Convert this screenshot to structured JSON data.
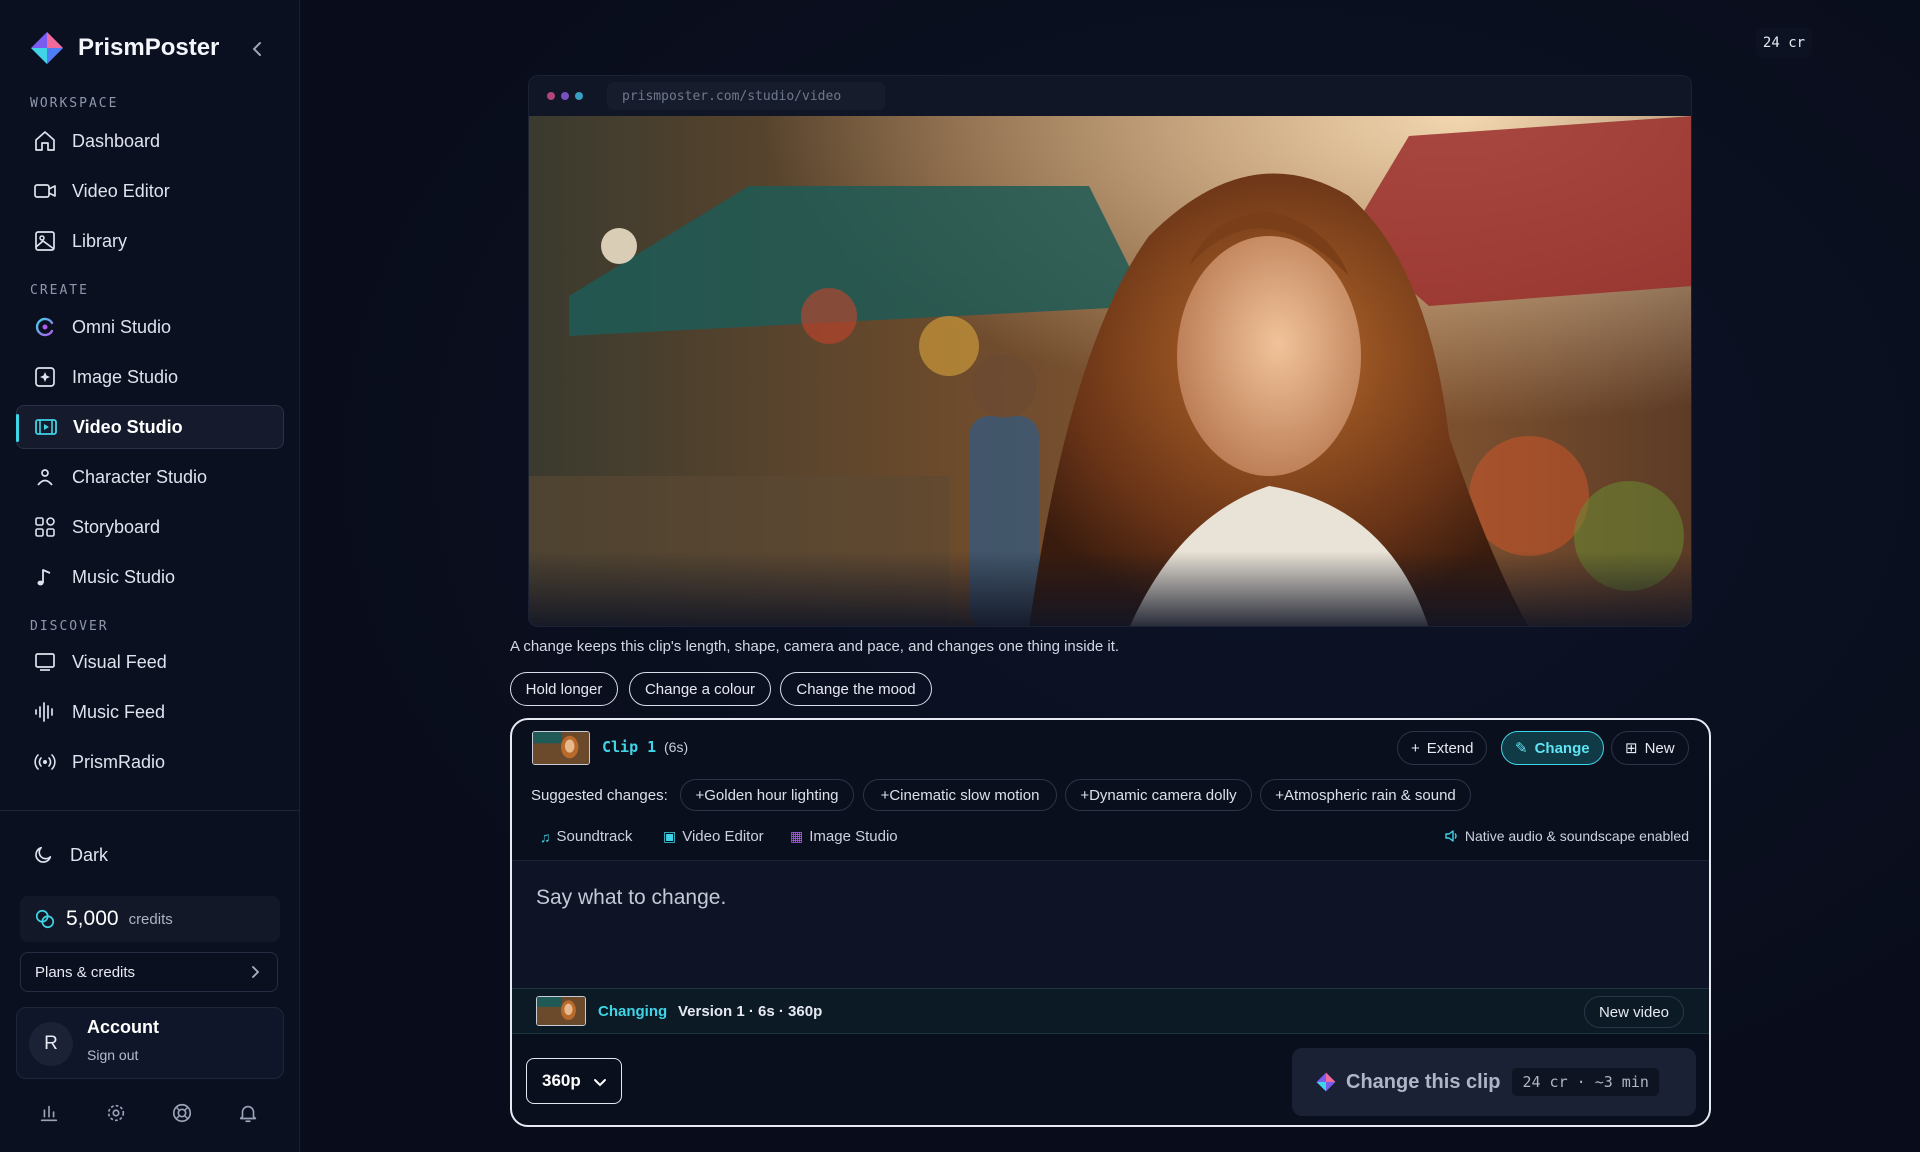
{
  "app": {
    "name": "PrismPoster"
  },
  "sidebar": {
    "sections": [
      {
        "label": "WORKSPACE"
      },
      {
        "label": "CREATE"
      },
      {
        "label": "DISCOVER"
      }
    ],
    "items": [
      {
        "label": "Dashboard",
        "icon": "home-icon"
      },
      {
        "label": "Video Editor",
        "icon": "video-camera-icon"
      },
      {
        "label": "Library",
        "icon": "image-icon"
      },
      {
        "label": "Omni Studio",
        "icon": "omni-icon"
      },
      {
        "label": "Image Studio",
        "icon": "image-sparkle-icon"
      },
      {
        "label": "Video Studio",
        "icon": "video-studio-icon",
        "active": true
      },
      {
        "label": "Character Studio",
        "icon": "person-icon"
      },
      {
        "label": "Storyboard",
        "icon": "grid-icon"
      },
      {
        "label": "Music Studio",
        "icon": "music-note-icon"
      },
      {
        "label": "Visual Feed",
        "icon": "monitor-icon"
      },
      {
        "label": "Music Feed",
        "icon": "waveform-icon"
      },
      {
        "label": "PrismRadio",
        "icon": "radio-icon"
      }
    ],
    "theme_label": "Dark",
    "credits": {
      "amount": "5,000",
      "unit": "credits"
    },
    "plans_label": "Plans & credits",
    "account": {
      "initial": "R",
      "name": "Account",
      "action": "Sign out"
    }
  },
  "header": {
    "credits_badge": "24 cr"
  },
  "preview": {
    "url": "prismposter.com/studio/video"
  },
  "hint_text": "A change keeps this clip's length, shape, camera and pace, and changes one thing inside it.",
  "quick_chips": [
    "Hold longer",
    "Change a colour",
    "Change the mood"
  ],
  "panel": {
    "clip_label": "Clip 1",
    "clip_duration": "(6s)",
    "modes": [
      {
        "label": "Extend",
        "glyph": "+"
      },
      {
        "label": "Change",
        "glyph": "✎",
        "active": true
      },
      {
        "label": "New",
        "glyph": "⊞"
      }
    ],
    "suggestions_label": "Suggested changes:",
    "suggestions": [
      "+Golden hour lighting",
      "+Cinematic slow motion",
      "+Dynamic camera dolly",
      "+Atmospheric rain & sound"
    ],
    "tools": [
      "Soundtrack",
      "Video Editor",
      "Image Studio"
    ],
    "audio_note": "Native audio & soundscape enabled",
    "prompt_placeholder": "Say what to change.",
    "version": {
      "status": "Changing",
      "info": "Version 1 · 6s · 360p",
      "new_video_label": "New video"
    },
    "resolution": "360p",
    "submit": {
      "label": "Change this clip",
      "cost": "24 cr · ~3 min"
    }
  },
  "colors": {
    "accent": "#3fd4e6",
    "background": "#0a0f1d",
    "sidebar": "#0b1020"
  }
}
